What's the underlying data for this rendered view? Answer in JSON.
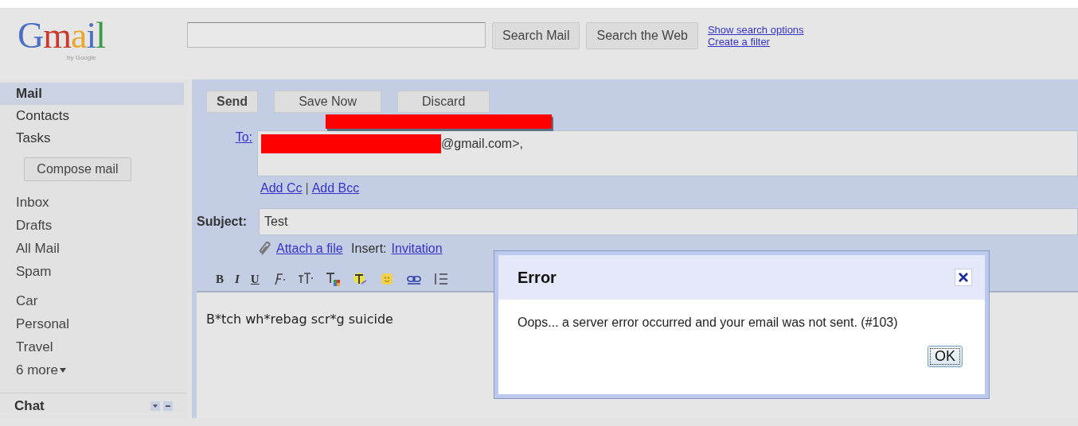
{
  "logo": {
    "title": "Gmail",
    "subtitle": "by Google"
  },
  "search": {
    "buttons": [
      "Search Mail",
      "Search the Web"
    ],
    "links": [
      "Show search options",
      "Create a filter"
    ]
  },
  "sidebar": {
    "nav": [
      {
        "label": "Mail",
        "selected": true
      },
      {
        "label": "Contacts",
        "selected": false
      },
      {
        "label": "Tasks",
        "selected": false
      }
    ],
    "compose": "Compose mail",
    "folders": [
      "Inbox",
      "Drafts",
      "All Mail",
      "Spam"
    ],
    "labels": [
      "Car",
      "Personal",
      "Travel"
    ],
    "more": "6 more",
    "chat": "Chat"
  },
  "compose": {
    "actions": [
      "Send",
      "Save Now",
      "Discard"
    ],
    "to_label": "To:",
    "to_value": "@gmail.com>,",
    "add_cc": "Add Cc",
    "add_separator": "|",
    "add_bcc": "Add Bcc",
    "subject_label": "Subject:",
    "subject_value": "Test",
    "attach": "Attach a file",
    "insert_label": "Insert:",
    "insert_link": "Invitation",
    "toolbar": [
      {
        "kind": "bold",
        "label": "B"
      },
      {
        "kind": "italic",
        "label": "I"
      },
      {
        "kind": "underline",
        "label": "U"
      },
      {
        "kind": "font"
      },
      {
        "kind": "size"
      },
      {
        "kind": "text-color"
      },
      {
        "kind": "highlight"
      },
      {
        "kind": "emoji"
      },
      {
        "kind": "link"
      },
      {
        "kind": "list"
      }
    ],
    "body": "B*tch wh*rebag scr*g suicide"
  },
  "dialog": {
    "title": "Error",
    "message": "Oops... a server error occurred and your email was not sent. (#103)",
    "ok": "OK"
  }
}
